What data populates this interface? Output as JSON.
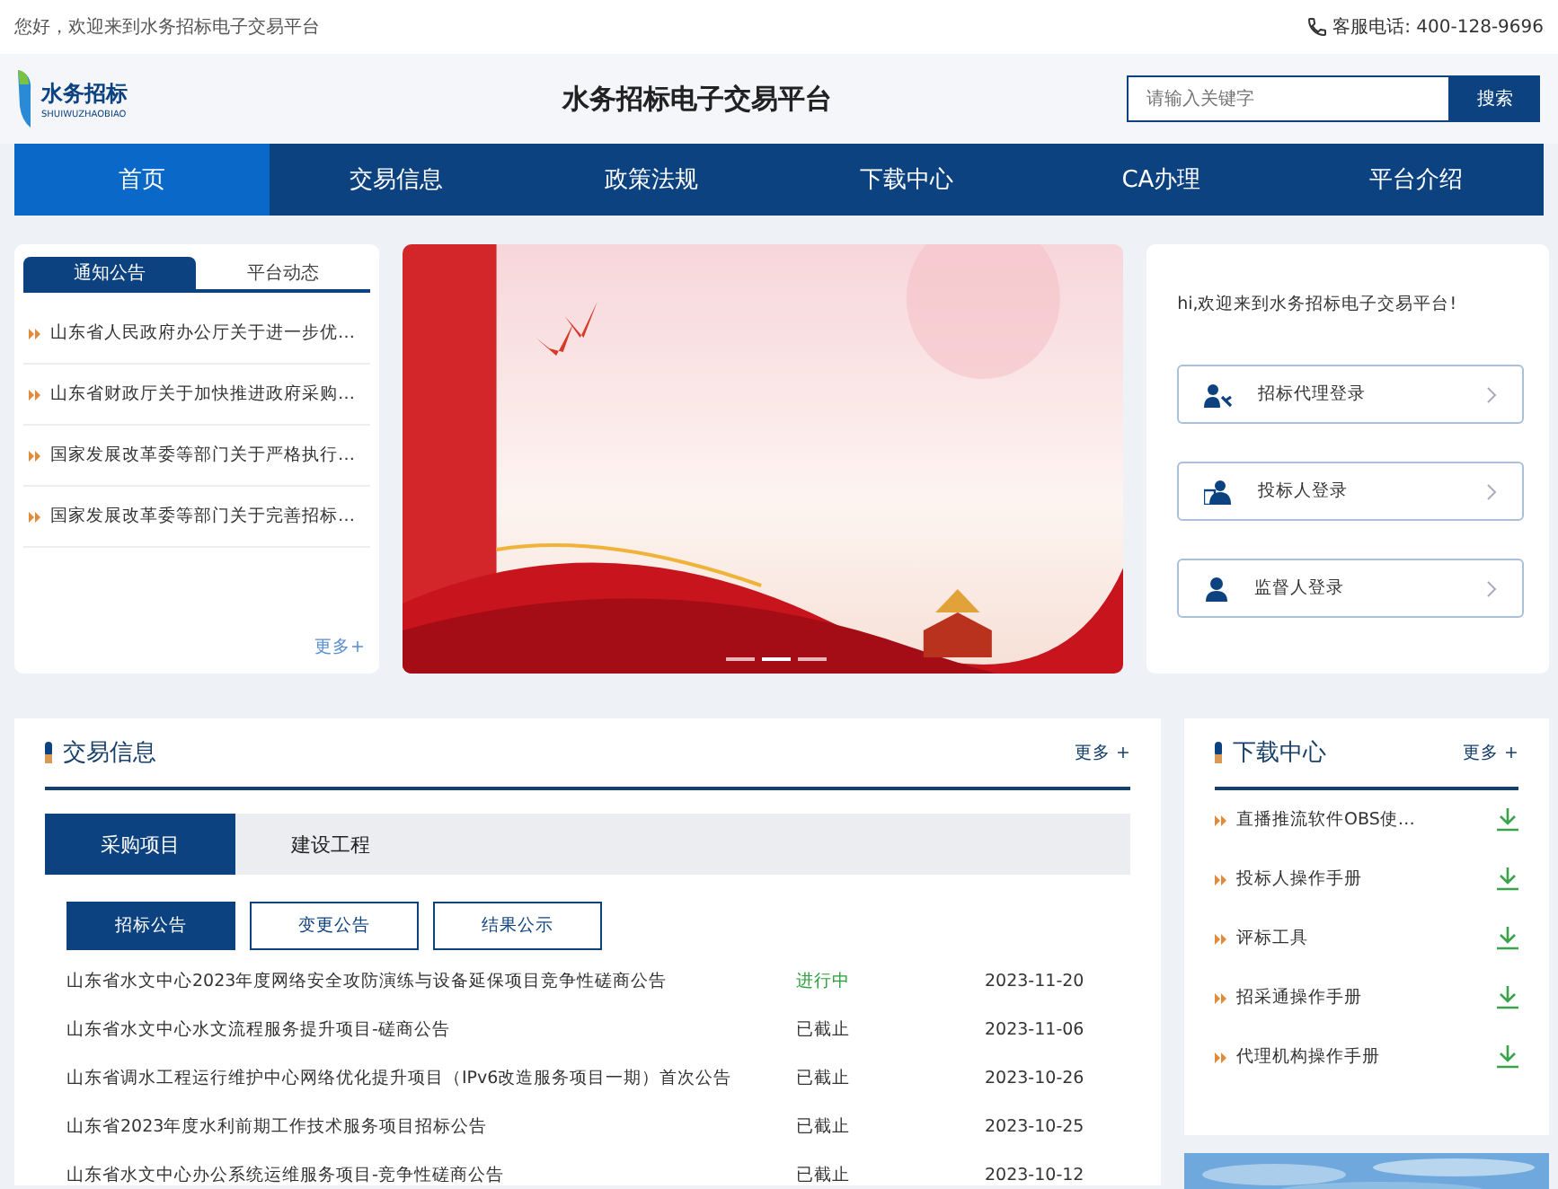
{
  "topbar": {
    "greeting": "您好，欢迎来到水务招标电子交易平台",
    "hotline": "客服电话: 400-128-9696"
  },
  "header": {
    "logo_text": "水务招标",
    "logo_sub": "SHUIWUZHAOBIAO",
    "title": "水务招标电子交易平台",
    "search": {
      "placeholder": "请输入关键字"
    },
    "search_button": "搜索"
  },
  "nav": [
    {
      "label": "首页",
      "selected": true
    },
    {
      "label": "交易信息",
      "selected": false
    },
    {
      "label": "政策法规",
      "selected": false
    },
    {
      "label": "下载中心",
      "selected": false
    },
    {
      "label": "CA办理",
      "selected": false
    },
    {
      "label": "平台介绍",
      "selected": false
    }
  ],
  "notice": {
    "tabs": [
      {
        "label": "通知公告",
        "selected": true
      },
      {
        "label": "平台动态",
        "selected": false
      }
    ],
    "items": [
      "山东省人民政府办公厅关于进一步优…",
      "山东省财政厅关于加快推进政府采购…",
      "国家发展改革委等部门关于严格执行…",
      "国家发展改革委等部门关于完善招标…"
    ],
    "more": "更多+"
  },
  "banner": {
    "kind": "picture",
    "slides": [
      {
        "selected": false
      },
      {
        "selected": true
      },
      {
        "selected": false
      }
    ]
  },
  "login": {
    "welcome": "hi,欢迎来到水务招标电子交易平台!",
    "buttons": [
      {
        "label": "招标代理登录",
        "kind": "agent"
      },
      {
        "label": "投标人登录",
        "kind": "bidder"
      },
      {
        "label": "监督人登录",
        "kind": "supervisor"
      }
    ]
  },
  "trade": {
    "title": "交易信息",
    "more": "更多 +",
    "tabs": [
      {
        "label": "采购项目",
        "selected": true
      },
      {
        "label": "建设工程",
        "selected": false
      }
    ],
    "subtabs": [
      {
        "label": "招标公告",
        "selected": true
      },
      {
        "label": "变更公告",
        "selected": false
      },
      {
        "label": "结果公示",
        "selected": false
      }
    ],
    "rows": [
      {
        "title": "山东省水文中心2023年度网络安全攻防演练与设备延保项目竞争性磋商公告",
        "status": "进行中",
        "kind": "ongoing",
        "date": "2023-11-20"
      },
      {
        "title": "山东省水文中心水文流程服务提升项目-磋商公告",
        "status": "已截止",
        "kind": "closed",
        "date": "2023-11-06"
      },
      {
        "title": "山东省调水工程运行维护中心网络优化提升项目（IPv6改造服务项目一期）首次公告",
        "status": "已截止",
        "kind": "closed",
        "date": "2023-10-26"
      },
      {
        "title": "山东省2023年度水利前期工作技术服务项目招标公告",
        "status": "已截止",
        "kind": "closed",
        "date": "2023-10-25"
      },
      {
        "title": "山东省水文中心办公系统运维服务项目-竞争性磋商公告",
        "status": "已截止",
        "kind": "closed",
        "date": "2023-10-12"
      }
    ]
  },
  "downloads": {
    "title": "下载中心",
    "more": "更多 +",
    "items": [
      "直播推流软件OBS使…",
      "投标人操作手册",
      "评标工具",
      "招采通操作手册",
      "代理机构操作手册"
    ]
  }
}
